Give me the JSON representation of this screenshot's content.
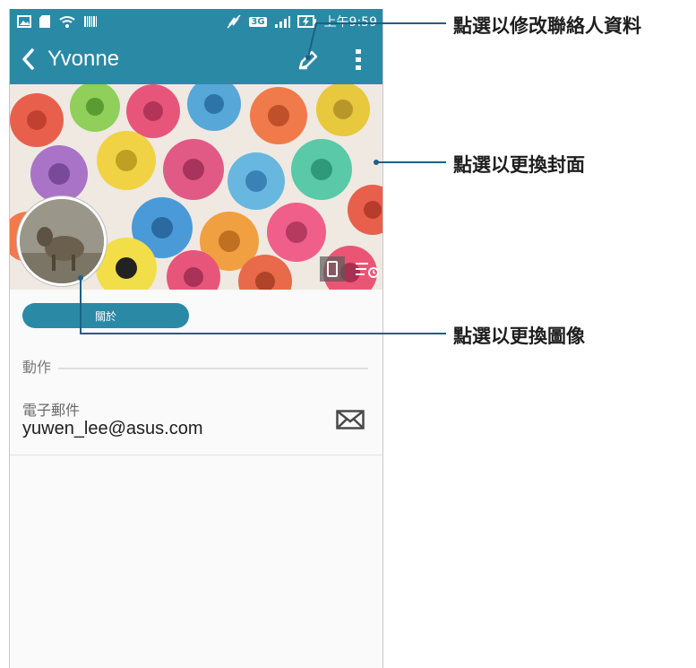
{
  "status_bar": {
    "time": "上午9:59",
    "network": "3G",
    "icons": [
      "image-icon",
      "sd-card-icon",
      "wifi-question-icon",
      "barcode-icon",
      "mute-icon",
      "3g-icon",
      "signal-icon",
      "battery-charging-icon"
    ]
  },
  "app_bar": {
    "contact_name": "Yvonne",
    "back_icon": "chevron-left-icon",
    "edit_icon": "pencil-icon",
    "more_icon": "overflow-menu-icon",
    "color": "#2a8aa6"
  },
  "cover": {
    "photo_icon": "phone-icon",
    "settings_icon": "list-clock-icon"
  },
  "about_tab": {
    "label": "關於"
  },
  "actions_section": {
    "label": "動作"
  },
  "email": {
    "label": "電子郵件",
    "value": "yuwen_lee@asus.com",
    "icon": "envelope-icon"
  },
  "callouts": {
    "edit_contact": "點選以修改聯絡人資料",
    "change_cover": "點選以更換封面",
    "change_avatar": "點選以更換圖像"
  },
  "accent_color": "#2a8aa6",
  "callout_line_color": "#1f5f86"
}
